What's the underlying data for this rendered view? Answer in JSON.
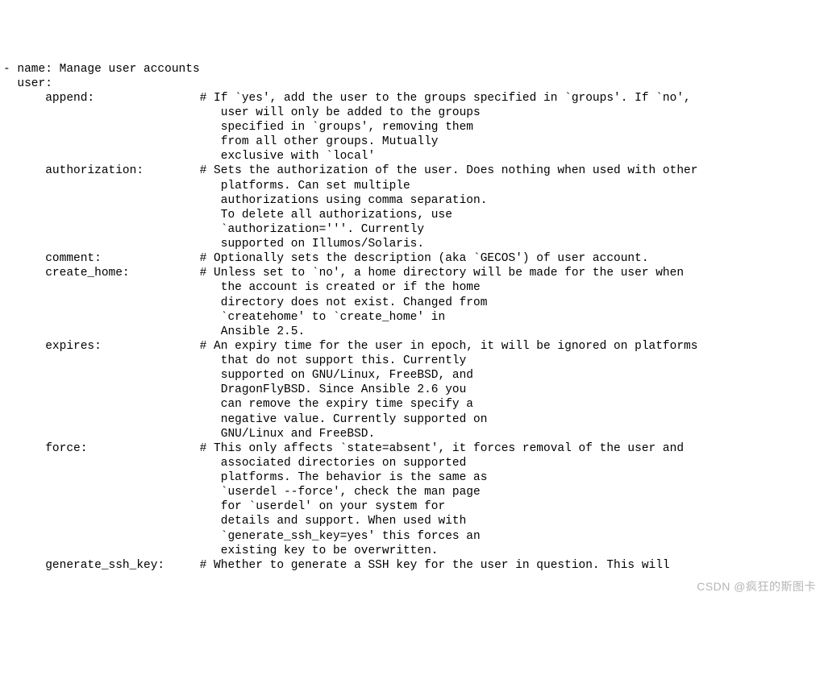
{
  "lines": [
    "- name: Manage user accounts",
    "  user:",
    "      append:               # If `yes', add the user to the groups specified in `groups'. If `no',",
    "                               user will only be added to the groups",
    "                               specified in `groups', removing them",
    "                               from all other groups. Mutually",
    "                               exclusive with `local'",
    "      authorization:        # Sets the authorization of the user. Does nothing when used with other",
    "                               platforms. Can set multiple",
    "                               authorizations using comma separation.",
    "                               To delete all authorizations, use",
    "                               `authorization='''. Currently",
    "                               supported on Illumos/Solaris.",
    "      comment:              # Optionally sets the description (aka `GECOS') of user account.",
    "      create_home:          # Unless set to `no', a home directory will be made for the user when",
    "                               the account is created or if the home",
    "                               directory does not exist. Changed from",
    "                               `createhome' to `create_home' in",
    "                               Ansible 2.5.",
    "      expires:              # An expiry time for the user in epoch, it will be ignored on platforms",
    "                               that do not support this. Currently",
    "                               supported on GNU/Linux, FreeBSD, and",
    "                               DragonFlyBSD. Since Ansible 2.6 you",
    "                               can remove the expiry time specify a",
    "                               negative value. Currently supported on",
    "                               GNU/Linux and FreeBSD.",
    "      force:                # This only affects `state=absent', it forces removal of the user and",
    "                               associated directories on supported",
    "                               platforms. The behavior is the same as",
    "                               `userdel --force', check the man page",
    "                               for `userdel' on your system for",
    "                               details and support. When used with",
    "                               `generate_ssh_key=yes' this forces an",
    "                               existing key to be overwritten.",
    "      generate_ssh_key:     # Whether to generate a SSH key for the user in question. This will"
  ],
  "watermark": "CSDN @疯狂的斯图卡"
}
